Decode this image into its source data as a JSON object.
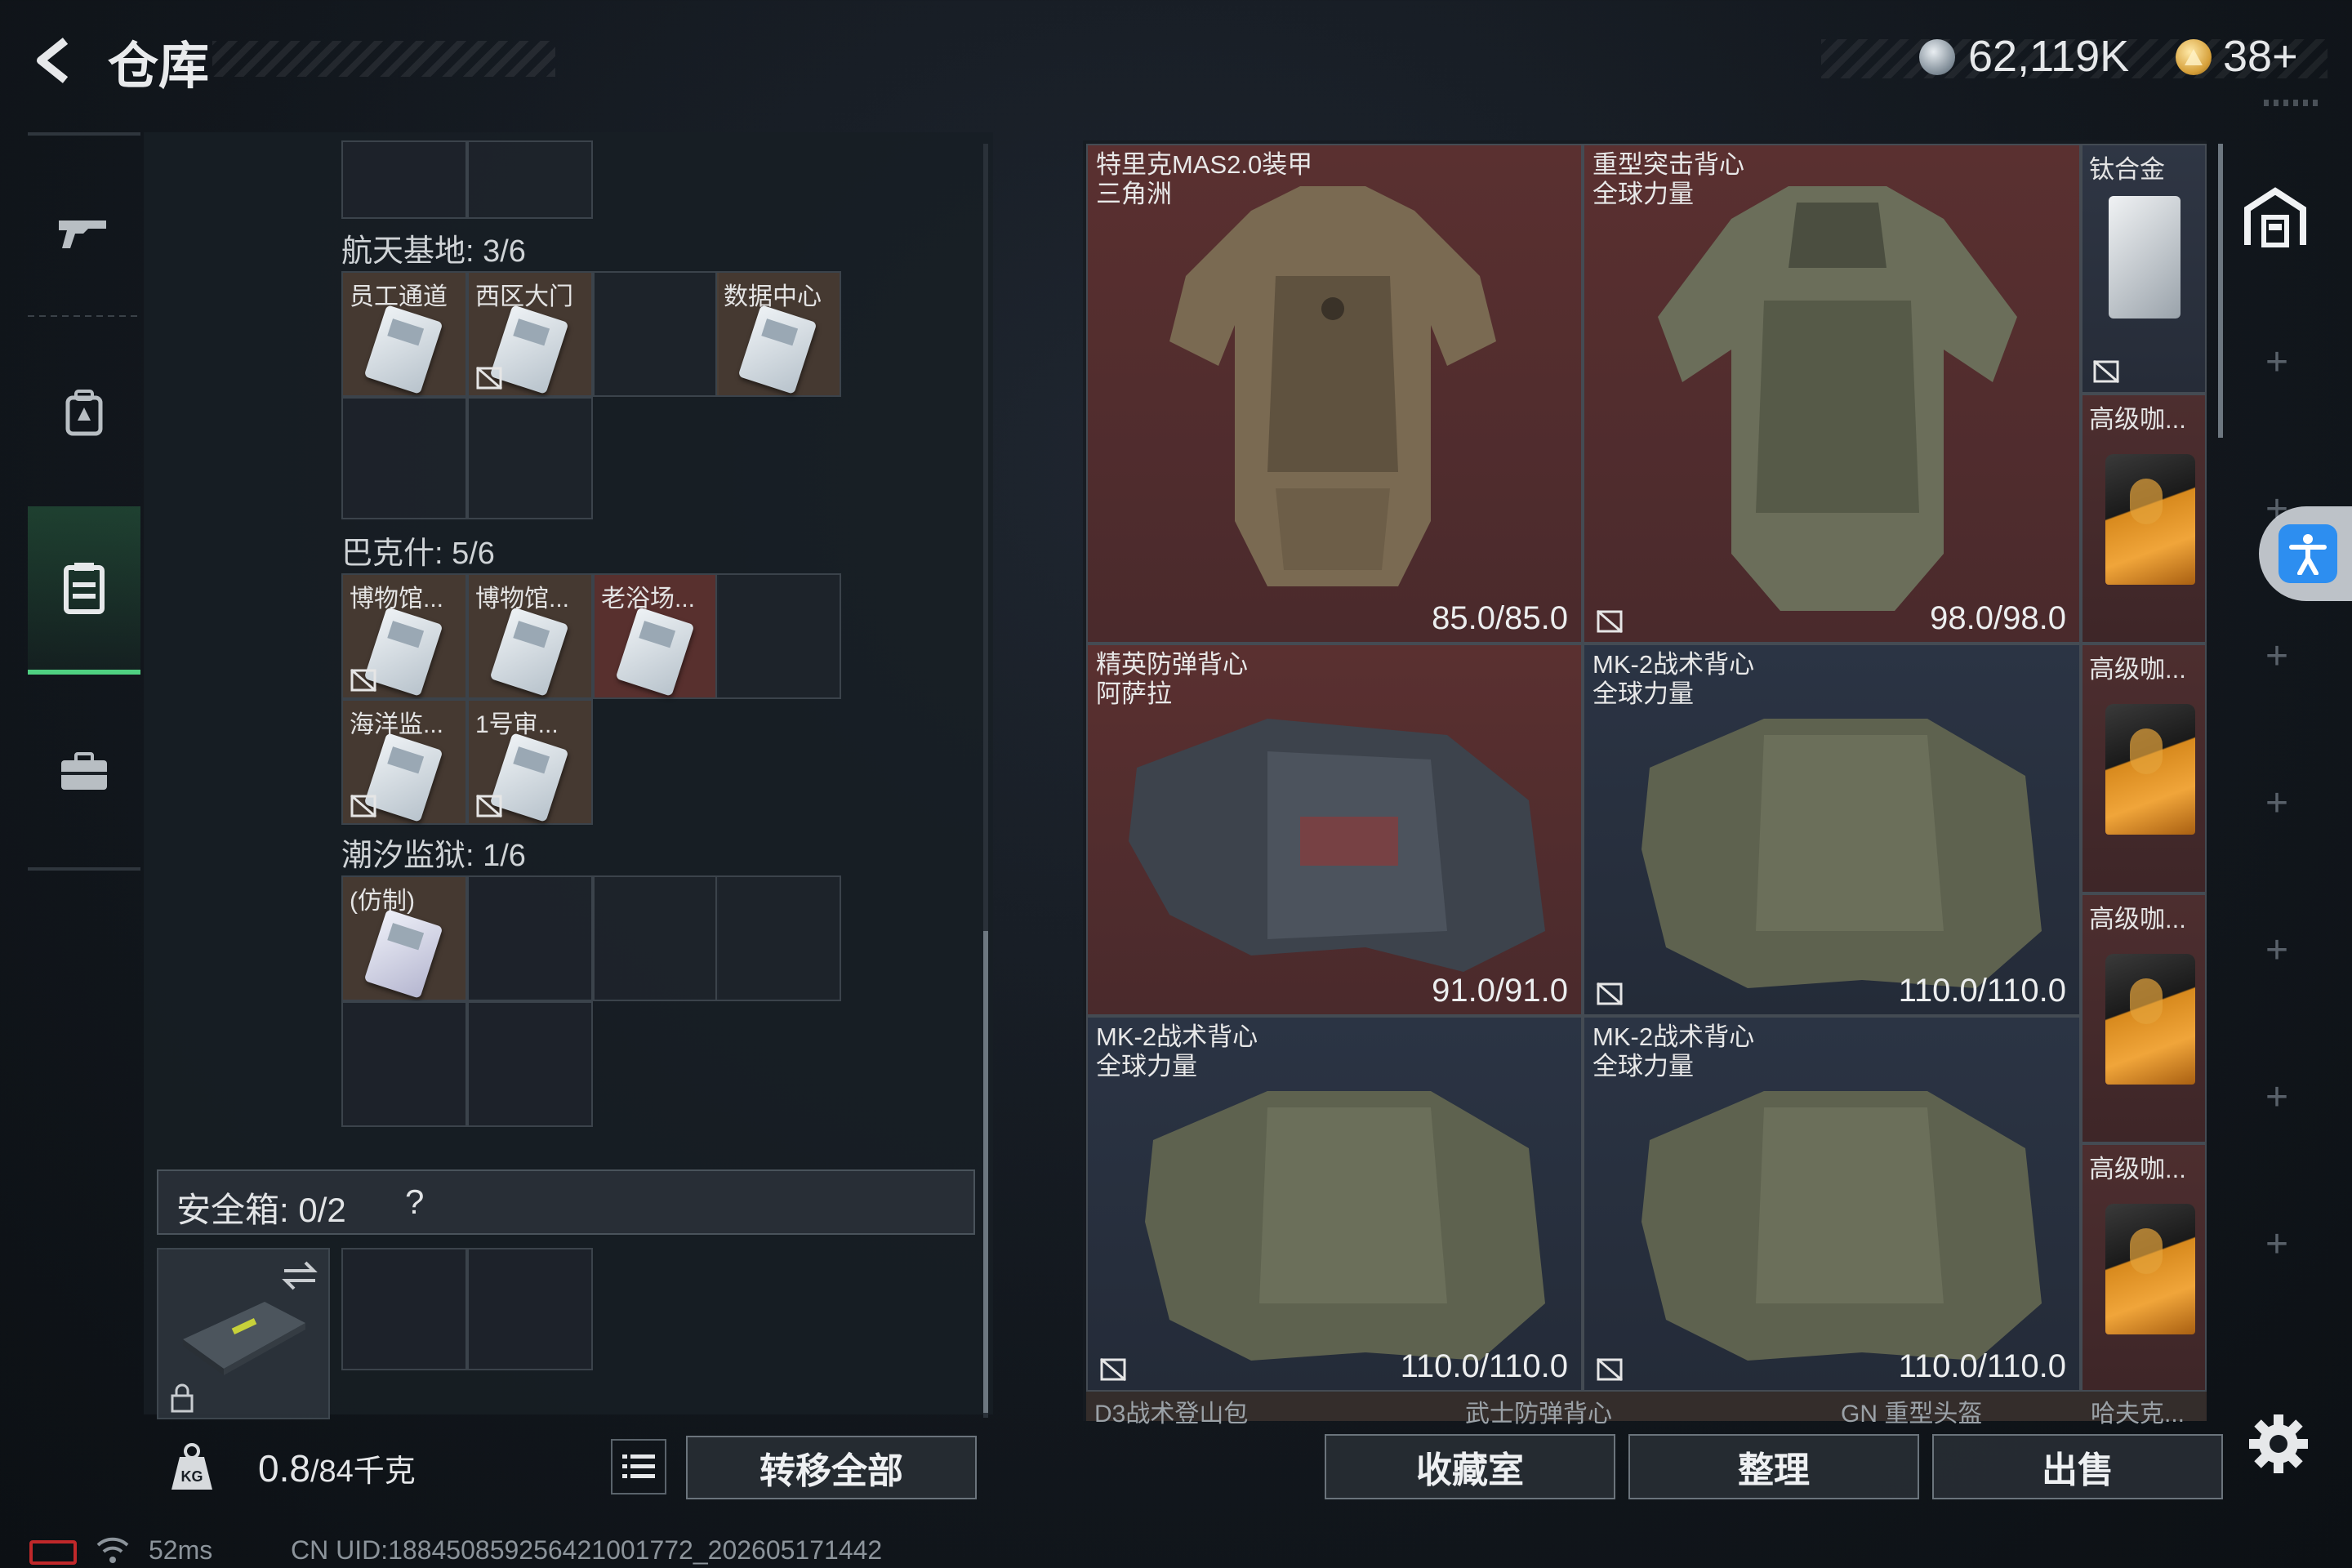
{
  "header": {
    "title": "仓库",
    "money": "62,119K",
    "tickets": "38+"
  },
  "nav": {
    "items": [
      "weapon-icon",
      "backpack-icon",
      "storage-icon",
      "briefcase-icon"
    ],
    "active": 2
  },
  "groups": [
    {
      "label": "航天基地: 3/6",
      "cards": [
        "员工通道",
        "西区大门",
        "数据中心"
      ]
    },
    {
      "label": "巴克什: 5/6",
      "cards": [
        "博物馆...",
        "博物馆...",
        "老浴场...",
        "海洋监...",
        "1号审..."
      ]
    },
    {
      "label": "潮汐监狱: 1/6",
      "cards": [
        "(仿制)"
      ]
    }
  ],
  "safe_box": {
    "label": "安全箱: 0/2",
    "help": "?"
  },
  "footer_left": {
    "weight": "0.8",
    "capacity": "/84千克",
    "transfer_all": "转移全部"
  },
  "grid": {
    "big_items": [
      {
        "name": "特里克MAS2.0装甲",
        "sub": "三角洲",
        "durability": "85.0/85.0"
      },
      {
        "name": "重型突击背心",
        "sub": "全球力量",
        "durability": "98.0/98.0"
      },
      {
        "name": "精英防弹背心",
        "sub": "阿萨拉",
        "durability": "91.0/91.0"
      },
      {
        "name": "MK-2战术背心",
        "sub": "全球力量",
        "durability": "110.0/110.0"
      },
      {
        "name": "MK-2战术背心",
        "sub": "全球力量",
        "durability": "110.0/110.0"
      },
      {
        "name": "MK-2战术背心",
        "sub": "全球力量",
        "durability": "110.0/110.0"
      }
    ],
    "side_items": [
      "钛合金",
      "高级咖...",
      "高级咖...",
      "高级咖...",
      "高级咖..."
    ],
    "peek_items": [
      "D3战术登山包",
      "武士防弹背心",
      "GN 重型头盔",
      "哈夫克..."
    ]
  },
  "buttons": {
    "collection": "收藏室",
    "sort": "整理",
    "sell": "出售"
  },
  "status": {
    "ping": "52ms",
    "uid": "CN UID:18845085925642100177​2_202605171442"
  },
  "colors": {
    "accent_green": "#4fd081",
    "item_red": "#5a3030",
    "item_blue": "#2b3444",
    "access_blue": "#2d8ef0"
  }
}
